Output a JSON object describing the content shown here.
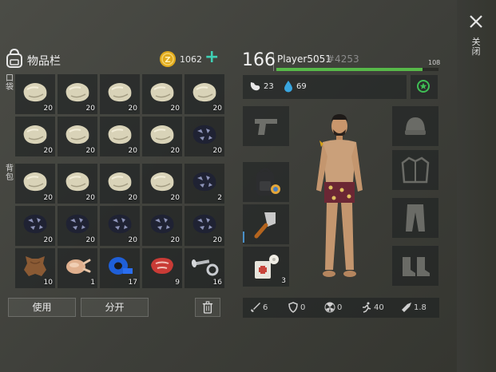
{
  "inventory": {
    "title": "物品栏",
    "coins": "1062",
    "pocket_label": "口袋",
    "backpack_label": "背包",
    "pocket": [
      {
        "item": "stone",
        "qty": "20"
      },
      {
        "item": "stone",
        "qty": "20"
      },
      {
        "item": "stone",
        "qty": "20"
      },
      {
        "item": "stone",
        "qty": "20"
      },
      {
        "item": "stone",
        "qty": "20"
      },
      {
        "item": "stone",
        "qty": "20"
      },
      {
        "item": "stone",
        "qty": "20"
      },
      {
        "item": "stone",
        "qty": "20"
      },
      {
        "item": "stone",
        "qty": "20"
      },
      {
        "item": "iron-ore",
        "qty": "20"
      }
    ],
    "backpack": [
      {
        "item": "stone",
        "qty": "20"
      },
      {
        "item": "stone",
        "qty": "20"
      },
      {
        "item": "stone",
        "qty": "20"
      },
      {
        "item": "stone",
        "qty": "20"
      },
      {
        "item": "iron-ore",
        "qty": "2"
      },
      {
        "item": "iron-ore",
        "qty": "20"
      },
      {
        "item": "iron-ore",
        "qty": "20"
      },
      {
        "item": "iron-ore",
        "qty": "20"
      },
      {
        "item": "iron-ore",
        "qty": "20"
      },
      {
        "item": "iron-ore",
        "qty": "20"
      },
      {
        "item": "leather",
        "qty": "10"
      },
      {
        "item": "chicken",
        "qty": "1"
      },
      {
        "item": "tape",
        "qty": "17"
      },
      {
        "item": "meat",
        "qty": "9"
      },
      {
        "item": "nails",
        "qty": "16"
      }
    ],
    "use_label": "使用",
    "split_label": "分开"
  },
  "player": {
    "level": "166",
    "name": "Player5051",
    "id": "#4253",
    "xp_max": "108",
    "xp_fraction": 0.9,
    "hunger": "23",
    "thirst": "69"
  },
  "equipment": {
    "medkit_qty": "3"
  },
  "stats": {
    "attack": "6",
    "defense": "0",
    "radiation": "0",
    "speed": "40",
    "damage": "1.8"
  },
  "close_label": "关闭",
  "colors": {
    "accent": "#3fd0b4",
    "xp": "#57b949",
    "coin": "#e0a91c",
    "water": "#39a6e0"
  }
}
